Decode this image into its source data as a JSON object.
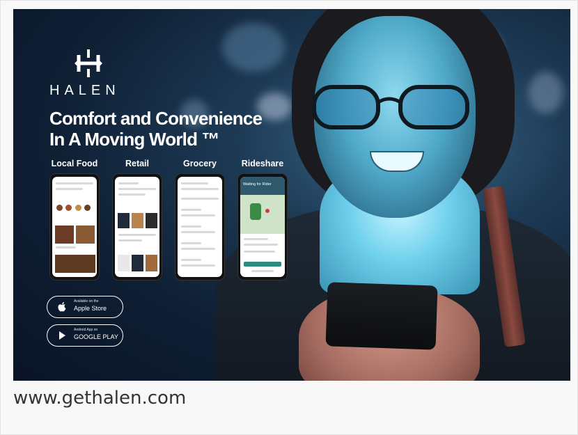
{
  "brand": {
    "name": "HALEN",
    "logo_icon": "halen-h-logo-icon"
  },
  "headline": {
    "line1": "Comfort and Convenience",
    "line2": "In A Moving World ™"
  },
  "categories": [
    {
      "label": "Local Food"
    },
    {
      "label": "Retail"
    },
    {
      "label": "Grocery"
    },
    {
      "label": "Rideshare"
    }
  ],
  "phones": {
    "rideshare_title": "Waiting for Rider"
  },
  "stores": {
    "apple": {
      "small": "Available on the",
      "big": "Apple Store",
      "icon": "apple-icon"
    },
    "google": {
      "small": "Android App on",
      "big": "GOOGLE PLAY",
      "icon": "play-icon"
    }
  },
  "footer": {
    "url": "www.gethalen.com"
  },
  "colors": {
    "background": "#f8f8f8",
    "banner_dark": "#0e1e33",
    "glow": "#6ed0ec",
    "text_light": "#ffffff",
    "url_text": "#333333"
  }
}
